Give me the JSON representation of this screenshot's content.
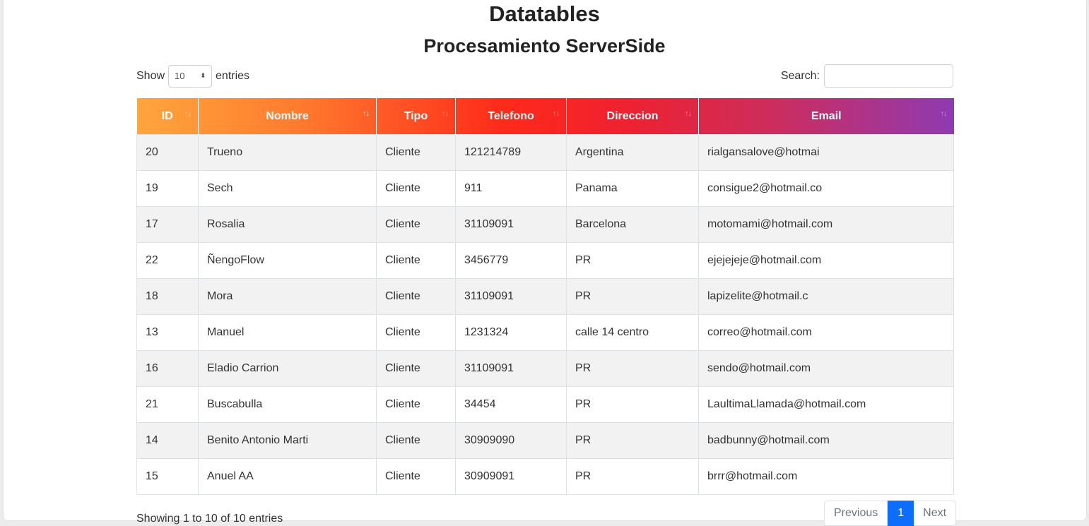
{
  "page": {
    "title": "Datatables",
    "subtitle": "Procesamiento ServerSide"
  },
  "length_menu": {
    "prefix": "Show",
    "selected": "10",
    "suffix": "entries"
  },
  "search": {
    "label": "Search:",
    "value": "",
    "placeholder": ""
  },
  "table": {
    "columns": [
      "ID",
      "Nombre",
      "Tipo",
      "Telefono",
      "Direccion",
      "Email"
    ],
    "sorted_column": "Nombre",
    "rows": [
      [
        "20",
        "Trueno",
        "Cliente",
        "121214789",
        "Argentina",
        "rialgansalove@hotmai"
      ],
      [
        "19",
        "Sech",
        "Cliente",
        "911",
        "Panama",
        "consigue2@hotmail.co"
      ],
      [
        "17",
        "Rosalia",
        "Cliente",
        "31109091",
        "Barcelona",
        "motomami@hotmail.com"
      ],
      [
        "22",
        "ÑengoFlow",
        "Cliente",
        "3456779",
        "PR",
        "ejejejeje@hotmail.com"
      ],
      [
        "18",
        "Mora",
        "Cliente",
        "31109091",
        "PR",
        "lapizelite@hotmail.c"
      ],
      [
        "13",
        "Manuel",
        "Cliente",
        "1231324",
        "calle 14 centro",
        "correo@hotmail.com"
      ],
      [
        "16",
        "Eladio Carrion",
        "Cliente",
        "31109091",
        "PR",
        "sendo@hotmail.com"
      ],
      [
        "21",
        "Buscabulla",
        "Cliente",
        "34454",
        "PR",
        "LaultimaLlamada@hotmail.com"
      ],
      [
        "14",
        "Benito Antonio Marti",
        "Cliente",
        "30909090",
        "PR",
        "badbunny@hotmail.com"
      ],
      [
        "15",
        "Anuel AA",
        "Cliente",
        "30909091",
        "PR",
        "brrr@hotmail.com"
      ]
    ]
  },
  "footer": {
    "info": "Showing 1 to 10 of 10 entries",
    "previous": "Previous",
    "current_page": "1",
    "next": "Next"
  },
  "icons": {
    "sort": "sort-arrows-icon",
    "select_caret": "up-down-caret-icon"
  },
  "colors": {
    "header_gradient_start": "#ffa63d",
    "header_gradient_mid": "#ff2a1a",
    "header_gradient_end": "#8f3ab2",
    "active_page": "#0d6efd"
  }
}
